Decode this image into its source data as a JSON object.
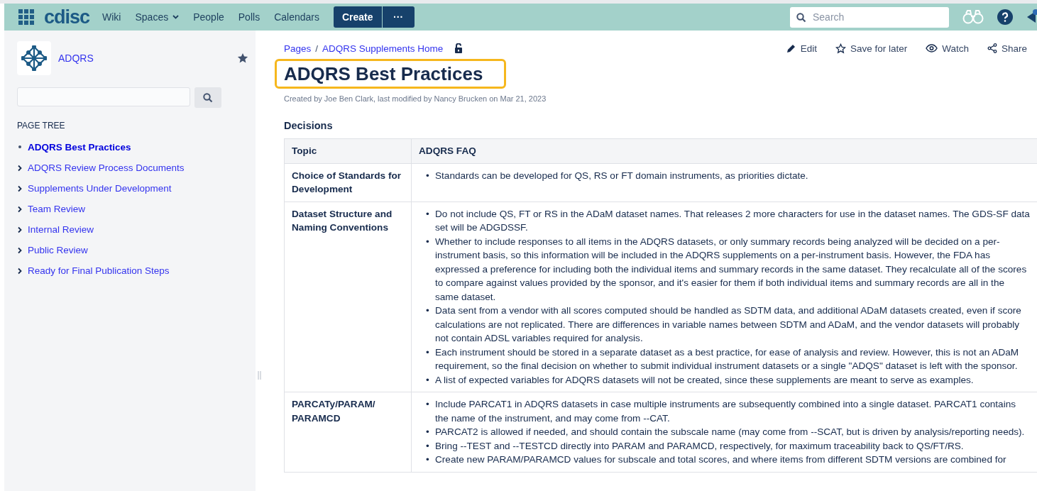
{
  "top_bar": {
    "logo": "cdisc",
    "nav": [
      {
        "label": "Wiki",
        "dropdown": false
      },
      {
        "label": "Spaces",
        "dropdown": true
      },
      {
        "label": "People",
        "dropdown": false
      },
      {
        "label": "Polls",
        "dropdown": false
      },
      {
        "label": "Calendars",
        "dropdown": false
      }
    ],
    "create_button": "Create",
    "more_button": "···",
    "search": {
      "placeholder": "Search"
    }
  },
  "sidebar": {
    "space_name": "ADQRS",
    "page_tree_heading": "PAGE TREE",
    "items": [
      {
        "label": "ADQRS Best Practices",
        "selected": true,
        "expandable": false
      },
      {
        "label": "ADQRS Review Process Documents",
        "selected": false,
        "expandable": true
      },
      {
        "label": "Supplements Under Development",
        "selected": false,
        "expandable": true
      },
      {
        "label": "Team Review",
        "selected": false,
        "expandable": true
      },
      {
        "label": "Internal Review",
        "selected": false,
        "expandable": true
      },
      {
        "label": "Public Review",
        "selected": false,
        "expandable": true
      },
      {
        "label": "Ready for Final Publication Steps",
        "selected": false,
        "expandable": true
      }
    ]
  },
  "breadcrumbs": [
    "Pages",
    "ADQRS Supplements Home"
  ],
  "breadcrumb_separator": "/",
  "actions": [
    {
      "kind": "edit",
      "label": "Edit"
    },
    {
      "kind": "save",
      "label": "Save for later"
    },
    {
      "kind": "watch",
      "label": "Watch"
    },
    {
      "kind": "share",
      "label": "Share"
    }
  ],
  "page": {
    "title": "ADQRS Best Practices",
    "byline": "Created by Joe Ben Clark, last modified by Nancy Brucken on Mar 21, 2023",
    "section_heading": "Decisions"
  },
  "table": {
    "columns": [
      "Topic",
      "ADQRS FAQ"
    ],
    "bullet": "•",
    "rows": [
      {
        "topic": "Choice of Standards for Development",
        "items": [
          "Standards can be developed for QS, RS or FT domain instruments, as priorities dictate."
        ]
      },
      {
        "topic": "Dataset Structure and Naming Conventions",
        "items": [
          "Do not include QS, FT or RS in the ADaM dataset names.  That releases 2 more characters for use in the dataset names.  The GDS-SF data set will be ADGDSSF.",
          "Whether to include responses to all items in the ADQRS datasets, or only summary records being analyzed will be decided on a per-instrument basis, so this information will be included in the ADQRS supplements on a per-instrument basis.  However, the FDA has expressed a preference for including both the individual items and summary records in the same dataset.  They recalculate all of the scores to compare against values provided by the sponsor, and it's easier for them if both individual items and summary records are all in the same dataset.",
          "Data sent from a vendor with all scores computed should be handled as SDTM data, and additional ADaM datasets created, even if score calculations are not replicated. There are differences in variable names between SDTM and ADaM, and the vendor datasets will probably not contain ADSL variables required for analysis.",
          "Each instrument should be stored in a separate dataset as a best practice, for ease of analysis and review.  However, this is not an ADaM requirement, so the final decision on whether to submit individual instrument datasets or a single \"ADQS\" dataset is left with the sponsor.",
          "A list of expected variables for ADQRS datasets will not be created, since these supplements are meant to serve as examples."
        ]
      },
      {
        "topic": "PARCATy/PARAM/ PARAMCD",
        "items": [
          "Include PARCAT1 in ADQRS datasets in case multiple instruments are subsequently combined into a single dataset.  PARCAT1 contains the name of the instrument, and may come from --CAT.",
          "PARCAT2 is allowed if needed, and should contain the subscale name (may come from --SCAT, but is driven by analysis/reporting needs).",
          "Bring --TEST and --TESTCD directly into PARAM and PARAMCD, respectively, for maximum traceability back to QS/FT/RS.",
          "Create new PARAM/PARAMCD values for subscale and total scores, and where items from different SDTM versions are combined for"
        ]
      }
    ]
  }
}
